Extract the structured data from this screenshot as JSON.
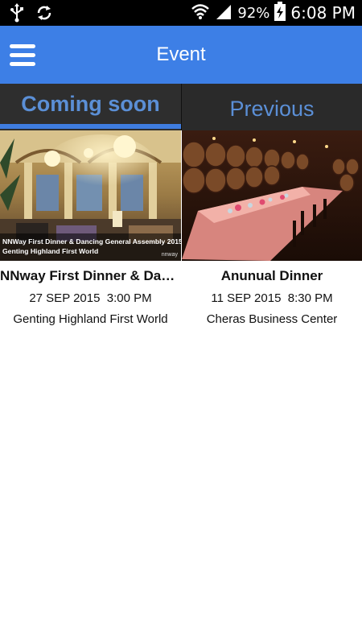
{
  "status_bar": {
    "battery": "92%",
    "time": "6:08 PM",
    "icons": [
      "usb-icon",
      "sync-icon",
      "wifi-icon",
      "signal-icon",
      "battery-charging-icon"
    ]
  },
  "app_bar": {
    "title": "Event",
    "menu_icon": "hamburger-menu-icon",
    "color": "#3d7fe6"
  },
  "tabs": [
    {
      "label": "Coming soon",
      "active": true
    },
    {
      "label": "Previous",
      "active": false
    }
  ],
  "events": [
    {
      "overlay_line1": "NNWay First Dinner & Dancing General Assembly 2015",
      "overlay_line2": "Genting Highland First World",
      "watermark": "nnway",
      "title": "NNway First Dinner & Dan…",
      "date": "27 SEP 2015  3:00 PM",
      "venue": "Genting Highland First World"
    },
    {
      "title": "Anunual Dinner",
      "date": "11 SEP 2015  8:30 PM",
      "venue": "Cheras Business Center"
    }
  ]
}
